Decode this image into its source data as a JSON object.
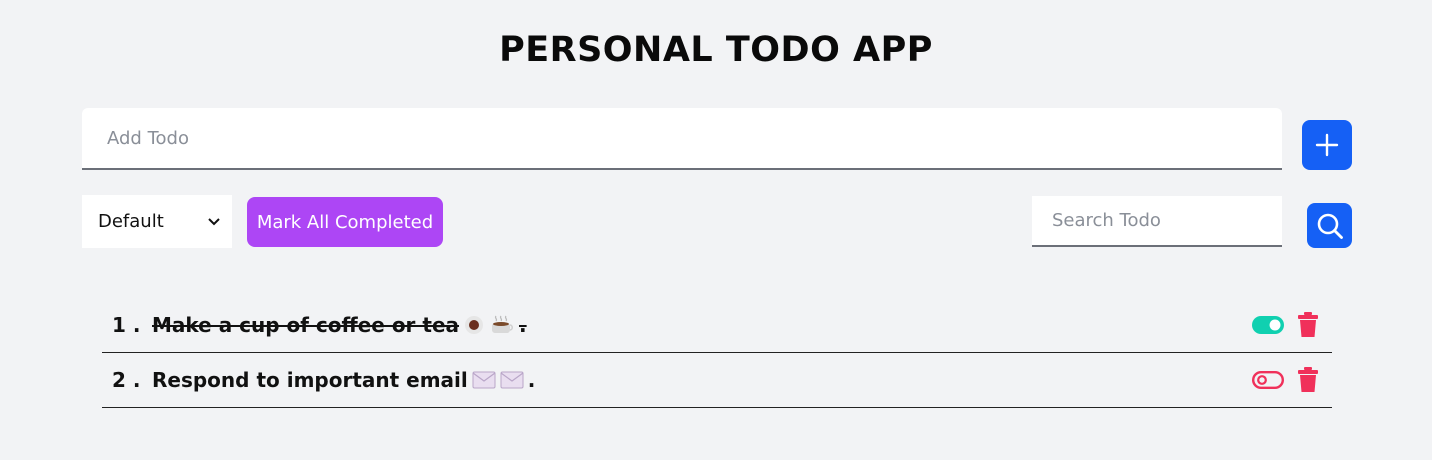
{
  "app": {
    "title": "PERSONAL TODO APP"
  },
  "add_bar": {
    "placeholder": "Add Todo",
    "value": "",
    "add_icon": "plus-icon"
  },
  "controls": {
    "filter_selected": "Default",
    "mark_all_label": "Mark All Completed",
    "search_placeholder": "Search Todo",
    "search_value": "",
    "search_icon": "magnifier-icon"
  },
  "todos": [
    {
      "number": "1 .",
      "text": "Make a cup of coffee or tea",
      "emojis": [
        "coffee-bean-icon",
        "hot-beverage-icon"
      ],
      "suffix": ".",
      "completed": true,
      "toggle_state": "on"
    },
    {
      "number": "2 .",
      "text": "Respond to important email",
      "emojis": [
        "envelope-icon",
        "envelope-icon"
      ],
      "suffix": ".",
      "completed": false,
      "toggle_state": "off"
    }
  ],
  "colors": {
    "background": "#f2f3f5",
    "primary_blue": "#1560f5",
    "purple": "#ad46f5",
    "toggle_on": "#10d0b0",
    "toggle_off": "#f0305a",
    "delete_red": "#f0305a"
  }
}
